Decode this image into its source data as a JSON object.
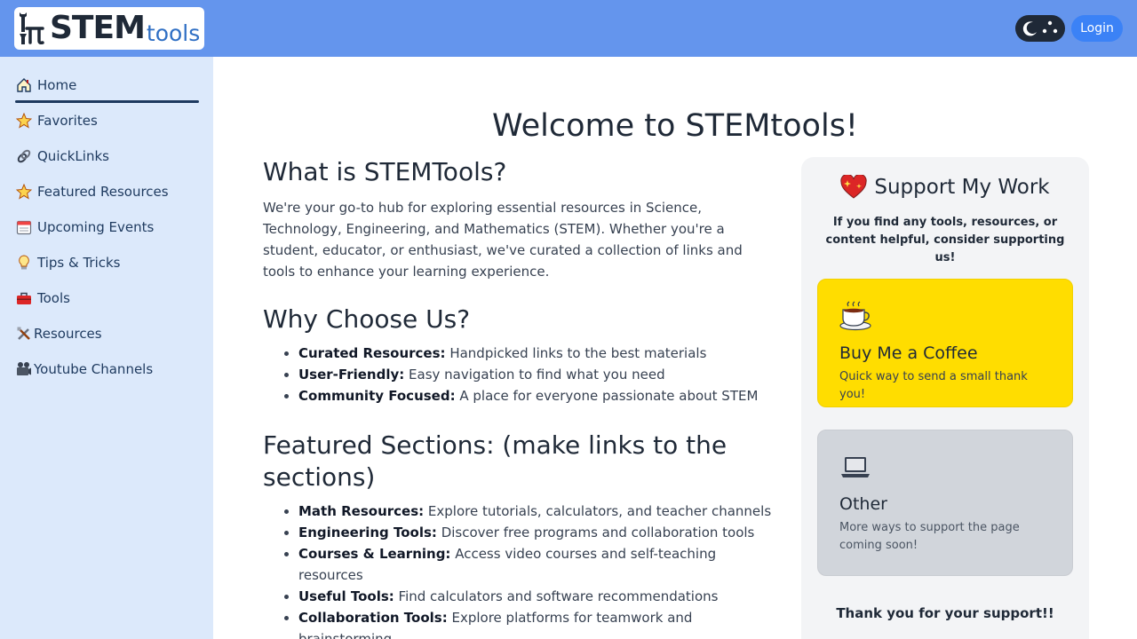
{
  "header": {
    "logo_main": "STEM",
    "logo_sub": "tools",
    "login_label": "Login"
  },
  "sidebar": {
    "items": [
      {
        "label": "Home",
        "icon": "house-icon"
      },
      {
        "label": "Favorites",
        "icon": "star-icon"
      },
      {
        "label": "QuickLinks",
        "icon": "link-icon"
      },
      {
        "label": "Featured Resources",
        "icon": "star-icon"
      },
      {
        "label": "Upcoming Events",
        "icon": "calendar-icon"
      },
      {
        "label": "Tips & Tricks",
        "icon": "lightbulb-icon"
      },
      {
        "label": "Tools",
        "icon": "toolbox-icon"
      },
      {
        "label": "Resources",
        "icon": "tools-icon"
      },
      {
        "label": "Youtube Channels",
        "icon": "video-camera-icon"
      }
    ]
  },
  "main": {
    "title": "Welcome to STEMtools!",
    "what_heading": "What is STEMTools?",
    "what_text": "We're your go-to hub for exploring essential resources in Science, Technology, Engineering, and Mathematics (STEM). Whether you're a student, educator, or enthusiast, we've curated a collection of links and tools to enhance your learning experience.",
    "why_heading": "Why Choose Us?",
    "why_items": [
      {
        "bold": "Curated Resources:",
        "text": " Handpicked links to the best materials"
      },
      {
        "bold": "User-Friendly:",
        "text": " Easy navigation to find what you need"
      },
      {
        "bold": "Community Focused:",
        "text": " A place for everyone passionate about STEM"
      }
    ],
    "featured_heading": "Featured Sections: (make links to the sections)",
    "featured_items": [
      {
        "bold": "Math Resources:",
        "text": " Explore tutorials, calculators, and teacher channels"
      },
      {
        "bold": "Engineering Tools:",
        "text": " Discover free programs and collaboration tools"
      },
      {
        "bold": "Courses & Learning:",
        "text": " Access video courses and self-teaching resources"
      },
      {
        "bold": "Useful Tools:",
        "text": " Find calculators and software recommendations"
      },
      {
        "bold": "Collaboration Tools:",
        "text": " Explore platforms for teamwork and brainstorming"
      }
    ]
  },
  "support": {
    "title": "Support My Work",
    "subtitle": "If you find any tools, resources, or content helpful, consider supporting us!",
    "cards": [
      {
        "title": "Buy Me a Coffee",
        "desc": "Quick way to send a small thank you!",
        "icon": "coffee-icon"
      },
      {
        "title": "Other",
        "desc": "More ways to support the page coming soon!",
        "icon": "laptop-icon"
      }
    ],
    "thanks": "Thank you for your support!!"
  },
  "colors": {
    "header_bg": "#6495ed",
    "sidebar_bg": "#dce9fb",
    "coffee_card": "#ffdd00",
    "other_card": "#d1d5db",
    "login_button": "#3b82f6"
  }
}
